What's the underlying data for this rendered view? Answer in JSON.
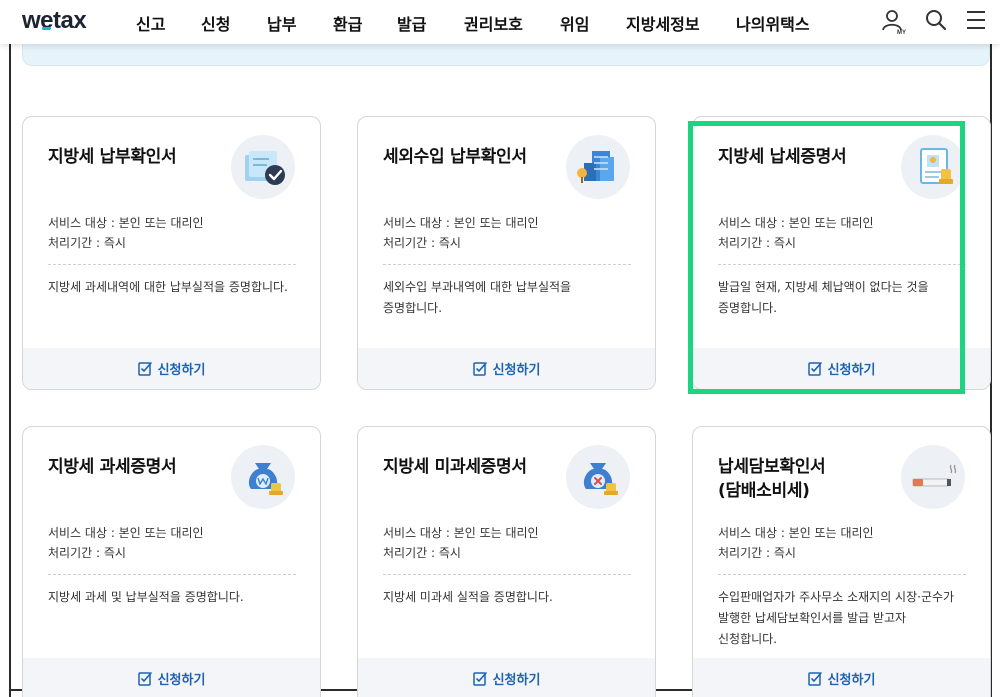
{
  "header": {
    "logo": {
      "pre": "w",
      "mid": "e",
      "post": "tax"
    },
    "nav": [
      "신고",
      "신청",
      "납부",
      "환급",
      "발급",
      "권리보호",
      "위임",
      "지방세정보",
      "나의위택스"
    ],
    "my_badge": "MY"
  },
  "common": {
    "target_label": "서비스 대상 : 본인 또는 대리인",
    "period_label": "처리기간 : 즉시",
    "apply_label": "신청하기"
  },
  "cards": [
    {
      "title": "지방세 납부확인서",
      "desc": "지방세 과세내역에 대한 납부실적을 증명합니다.",
      "icon": "scroll-check-icon"
    },
    {
      "title": "세외수입 납부확인서",
      "desc": "세외수입 부과내역에 대한 납부실적을 증명합니다.",
      "icon": "buildings-icon"
    },
    {
      "title": "지방세 납세증명서",
      "desc": "발급일 현재, 지방세 체납액이 없다는 것을 증명합니다.",
      "icon": "certificate-icon",
      "highlighted": true
    },
    {
      "title": "지방세 과세증명서",
      "desc": "지방세 과세 및 납부실적을 증명합니다.",
      "icon": "money-bag-won-icon"
    },
    {
      "title": "지방세 미과세증명서",
      "desc": "지방세 미과세 실적을 증명합니다.",
      "icon": "money-bag-x-icon"
    },
    {
      "title": "납세담보확인서\n(담배소비세)",
      "desc": "수입판매업자가 주사무소 소재지의 시장·군수가 발행한 납세담보확인서를 발급 받고자 신청합니다.",
      "icon": "cigarette-icon"
    }
  ],
  "colors": {
    "accent_blue": "#1d63b3",
    "highlight_green": "#1dd480",
    "logo_accent": "#15b8d8"
  }
}
